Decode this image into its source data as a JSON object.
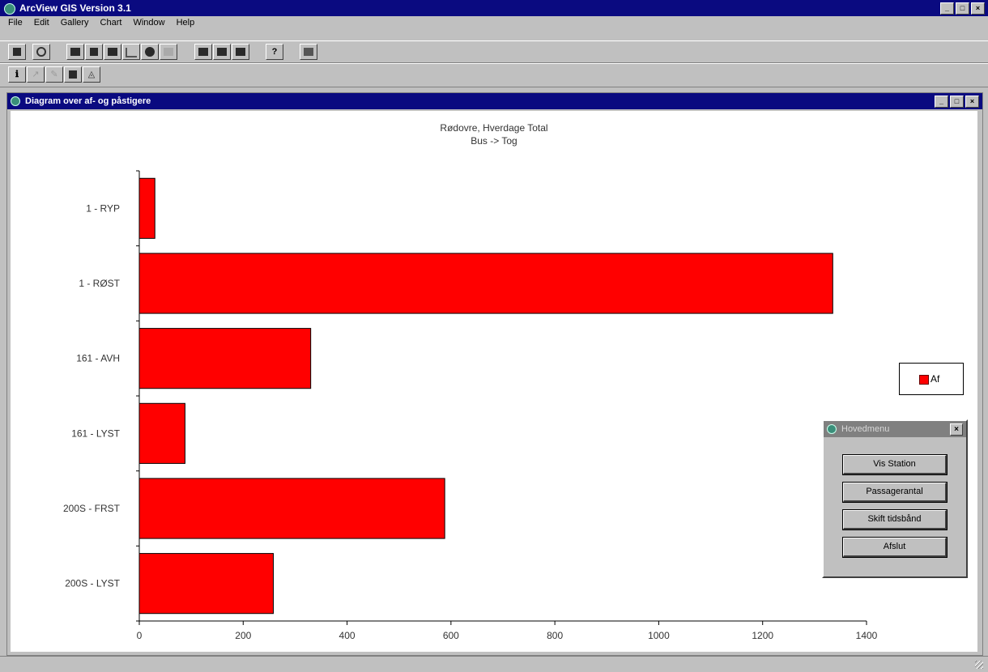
{
  "app": {
    "title": "ArcView GIS Version 3.1"
  },
  "menu": [
    "File",
    "Edit",
    "Gallery",
    "Chart",
    "Window",
    "Help"
  ],
  "window_controls": [
    "_",
    "□",
    "×"
  ],
  "chart_window": {
    "title": "Diagram over af- og påstigere"
  },
  "chart_data": {
    "type": "bar",
    "orientation": "horizontal",
    "title": "Rødovre, Hverdage Total",
    "subtitle": "Bus -> Tog",
    "categories": [
      "1 - RYP",
      "1 - RØST",
      "161 - AVH",
      "161 - LYST",
      "200S - FRST",
      "200S - LYST"
    ],
    "series": [
      {
        "name": "Af",
        "values": [
          30,
          1335,
          330,
          88,
          588,
          258
        ]
      }
    ],
    "xlim": [
      0,
      1400
    ],
    "xticks": [
      "0",
      "200",
      "400",
      "600",
      "800",
      "1000",
      "1200",
      "1400"
    ],
    "grid": false,
    "legend": "right",
    "bar_color": "#ff0000"
  },
  "dialog": {
    "title": "Hovedmenu",
    "buttons": [
      "Vis Station",
      "Passagerantal",
      "Skift tidsbånd",
      "Afslut"
    ]
  },
  "colors": {
    "titlebar": "#0a0a80",
    "chrome": "#c0c0c0",
    "bar": "#ff0000"
  }
}
